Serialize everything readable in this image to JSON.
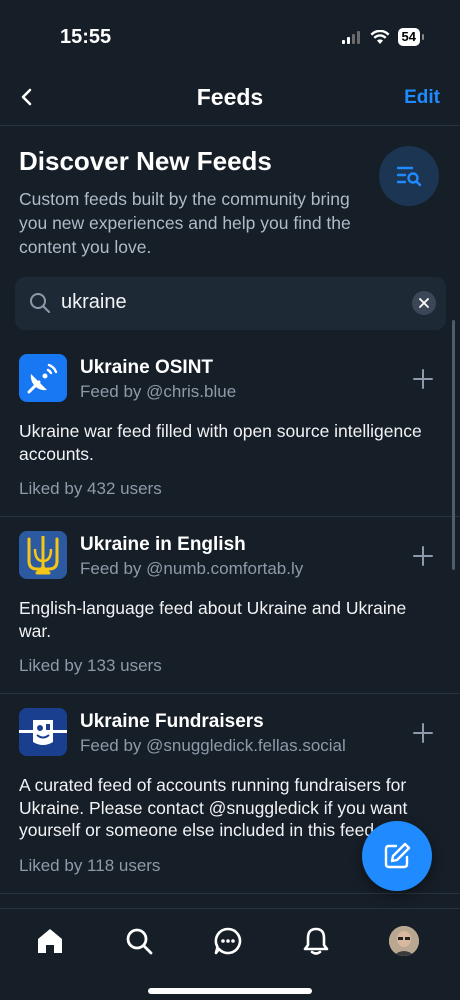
{
  "status_bar": {
    "time": "15:55",
    "battery": "54"
  },
  "header": {
    "title": "Feeds",
    "edit_label": "Edit"
  },
  "discover": {
    "title": "Discover New Feeds",
    "description": "Custom feeds built by the community bring you new experiences and help you find the content you love."
  },
  "search": {
    "value": "ukraine"
  },
  "feeds": [
    {
      "name": "Ukraine OSINT",
      "creator": "Feed by @chris.blue",
      "description": "Ukraine war feed filled with open source intelligence accounts.",
      "likes": "Liked by 432 users",
      "avatar_icon": "satellite-dish-icon"
    },
    {
      "name": "Ukraine in English",
      "creator": "Feed by @numb.comfortab.ly",
      "description": "English-language feed about Ukraine and Ukraine war.",
      "likes": "Liked by 133 users",
      "avatar_icon": "trident-icon"
    },
    {
      "name": "Ukraine Fundraisers",
      "creator": "Feed by @snuggledick.fellas.social",
      "description": "A curated feed of accounts running fundraisers for Ukraine. Please contact @snuggledick if you want yourself or someone else included in this feed.",
      "likes": "Liked by 118 users",
      "avatar_icon": "fundraiser-icon"
    }
  ],
  "tab_bar": {
    "items": [
      "home-icon",
      "search-icon",
      "chat-icon",
      "bell-icon",
      "profile-avatar"
    ]
  },
  "colors": {
    "background": "#161e27",
    "accent": "#208bfe",
    "muted_text": "#8d9aa9"
  }
}
